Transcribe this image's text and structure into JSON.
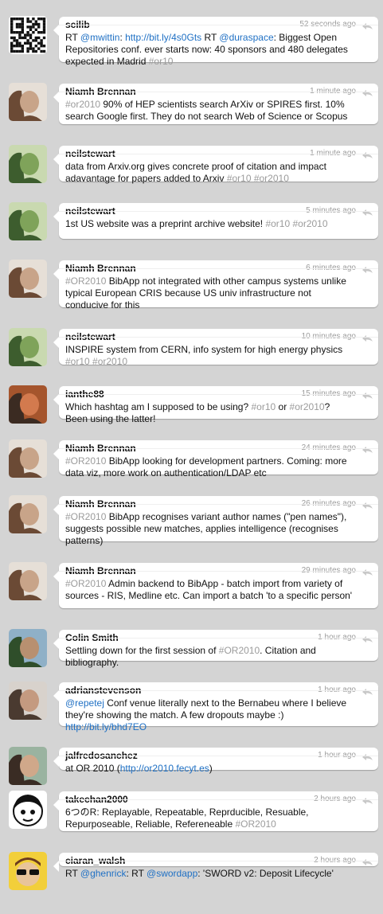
{
  "timeline": [
    {
      "user": "scilib",
      "time": "52 seconds ago",
      "avatar": "qr-code-avatar",
      "text": [
        [
          "",
          "RT "
        ],
        [
          "link",
          "@mwittin"
        ],
        [
          "",
          ": "
        ],
        [
          "link",
          "http://bit.ly/4s0Gts"
        ],
        [
          "",
          " RT "
        ],
        [
          "link",
          "@duraspace"
        ],
        [
          "",
          ": Biggest Open Repositories conf. ever starts now: 40 sponsors and 480 delegates expected in Madrid "
        ],
        [
          "tag",
          "#or10"
        ]
      ]
    },
    {
      "user": "Niamh Brennan",
      "time": "1 minute ago",
      "avatar": "user-photo-avatar",
      "text": [
        [
          "tag",
          "#or2010"
        ],
        [
          "",
          " 90% of HEP scientists search ArXiv or SPIRES first. 10% search Google first. They do not search Web of Science or Scopus"
        ]
      ]
    },
    {
      "user": "neilstewart",
      "time": "1 minute ago",
      "avatar": "user-photo-avatar",
      "text": [
        [
          "",
          "data from Arxiv.org gives concrete proof of citation and impact adavantage for papers added to Arxiv "
        ],
        [
          "tag",
          "#or10 #or2010"
        ]
      ]
    },
    {
      "user": "neilstewart",
      "time": "5 minutes ago",
      "avatar": "user-photo-avatar",
      "text": [
        [
          "",
          "1st US website was a preprint archive website! "
        ],
        [
          "tag",
          "#or10 #or2010"
        ]
      ]
    },
    {
      "user": "Niamh Brennan",
      "time": "6 minutes ago",
      "avatar": "user-photo-avatar",
      "text": [
        [
          "tag",
          "#OR2010"
        ],
        [
          "",
          " BibApp not integrated with other campus systems unlike typical European CRIS because US univ infrastructure not conducive for this"
        ]
      ]
    },
    {
      "user": "neilstewart",
      "time": "10 minutes ago",
      "avatar": "user-photo-avatar",
      "text": [
        [
          "",
          "INSPIRE system from CERN, info system for high energy physics "
        ],
        [
          "tag",
          "#or10 #or2010"
        ]
      ]
    },
    {
      "user": "ianthe88",
      "time": "15 minutes ago",
      "avatar": "user-photo-avatar",
      "text": [
        [
          "",
          "Which hashtag am I supposed to be using? "
        ],
        [
          "tag",
          "#or10"
        ],
        [
          "",
          " or "
        ],
        [
          "tag",
          "#or2010"
        ],
        [
          "",
          "? Been using the latter!"
        ]
      ]
    },
    {
      "user": "Niamh Brennan",
      "time": "24 minutes ago",
      "avatar": "user-photo-avatar",
      "text": [
        [
          "tag",
          "#OR2010"
        ],
        [
          "",
          " BibApp looking for development partners. Coming: more data viz, more work on authentication/LDAP etc"
        ]
      ]
    },
    {
      "user": "Niamh Brennan",
      "time": "26 minutes ago",
      "avatar": "user-photo-avatar",
      "text": [
        [
          "tag",
          "#OR2010"
        ],
        [
          "",
          " BibApp recognises variant author names (\"pen names\"), suggests possible new matches, applies intelligence (recognises patterns)"
        ]
      ]
    },
    {
      "user": "Niamh Brennan",
      "time": "29 minutes ago",
      "avatar": "user-photo-avatar",
      "text": [
        [
          "tag",
          "#OR2010"
        ],
        [
          "",
          " Admin backend to BibApp - batch import from variety of sources - RIS, Medline etc. Can import a batch 'to a specific person'"
        ]
      ]
    },
    {
      "user": "Colin Smith",
      "time": "1 hour ago",
      "avatar": "user-photo-avatar",
      "text": [
        [
          "",
          "Settling down for the first session of "
        ],
        [
          "tag",
          "#OR2010"
        ],
        [
          "",
          ". Citation and bibliography."
        ]
      ]
    },
    {
      "user": "adrianstevenson",
      "time": "1 hour ago",
      "avatar": "user-photo-avatar",
      "text": [
        [
          "link",
          "@repetej"
        ],
        [
          "",
          " Conf venue literally next to the Bernabeu where I believe they're showing the match. A few dropouts maybe :) "
        ],
        [
          "link",
          "http://bit.ly/bhd7EO"
        ]
      ]
    },
    {
      "user": "jalfredosanchez",
      "time": "1 hour ago",
      "avatar": "user-photo-avatar",
      "text": [
        [
          "",
          "at OR 2010 ("
        ],
        [
          "link",
          "http://or2010.fecyt.es"
        ],
        [
          "",
          ")"
        ]
      ]
    },
    {
      "user": "takechan2000",
      "time": "2 hours ago",
      "avatar": "cartoon-avatar",
      "text": [
        [
          "",
          "6つのR: Replayable, Repeatable, Reprducible, Resuable, Repurposeable, Reliable, Refereneable "
        ],
        [
          "tag",
          "#OR2010"
        ]
      ]
    },
    {
      "user": "ciaran_walsh",
      "time": "2 hours ago",
      "avatar": "cartoon-avatar",
      "text": [
        [
          "",
          "RT "
        ],
        [
          "link",
          "@ghenrick"
        ],
        [
          "",
          ": RT "
        ],
        [
          "link",
          "@swordapp"
        ],
        [
          "",
          ": 'SWORD v2: Deposit Lifecycle'"
        ]
      ]
    }
  ],
  "colors": {
    "link": "#1f70c4",
    "hashtag": "#9b9b9b",
    "background": "#d4d4d4"
  }
}
